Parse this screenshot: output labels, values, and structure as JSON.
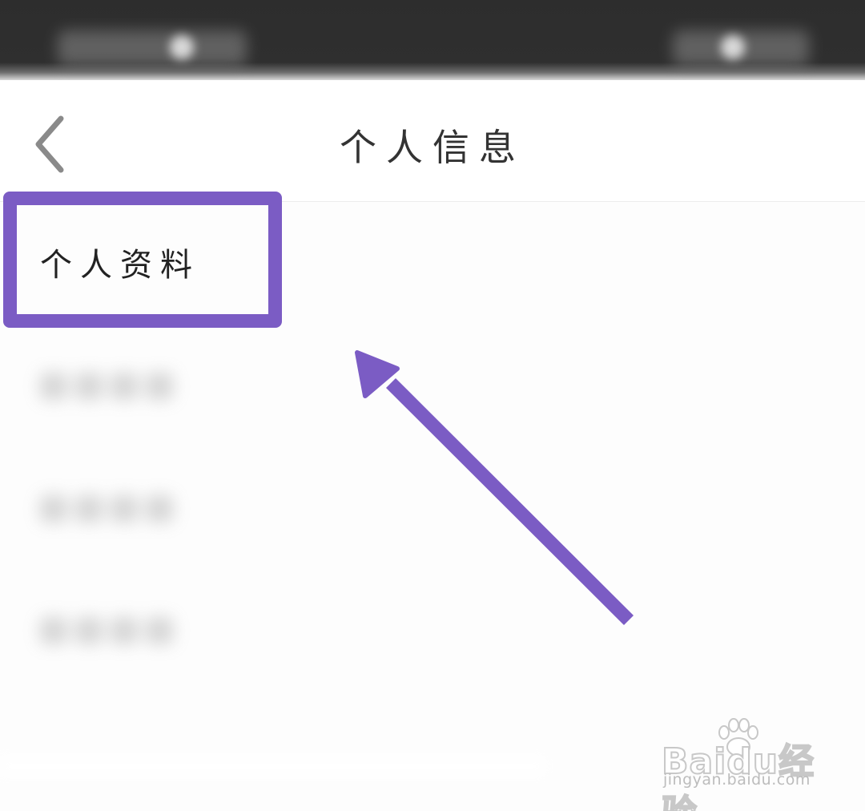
{
  "header": {
    "title": "个人信息"
  },
  "list": {
    "items": [
      {
        "label": "个人资料"
      }
    ]
  },
  "annotation": {
    "highlight_color": "#7b5cc4"
  },
  "watermark": {
    "brand": "Baidu经验",
    "url": "jingyan.baidu.com"
  }
}
